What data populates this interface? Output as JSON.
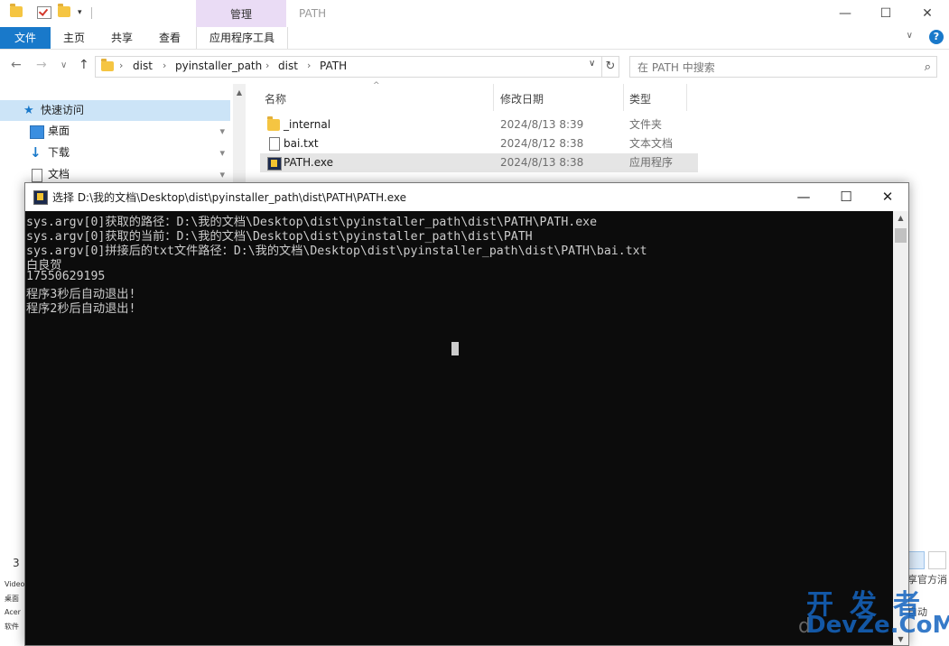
{
  "explorer": {
    "title": "PATH",
    "quick_access_dropdown": "▾",
    "manage_tab": "管理",
    "window_buttons": {
      "minimize": "—",
      "maximize": "☐",
      "close": "✕"
    },
    "ribbon_tabs": [
      "文件",
      "主页",
      "共享",
      "查看",
      "应用程序工具"
    ],
    "ribbon_chevron": "∨",
    "help": "?",
    "nav_buttons": {
      "back": "←",
      "forward": "→",
      "recent": "∨",
      "up": "↑"
    },
    "breadcrumbs": [
      "dist",
      "pyinstaller_path",
      "dist",
      "PATH"
    ],
    "breadcrumb_sep": "›",
    "address_dropdown": "∨",
    "refresh": "↻",
    "search_placeholder": "在 PATH 中搜索",
    "search_glyph": "⌕",
    "nav_pane": {
      "quick_access": "快速访问",
      "items": [
        "桌面",
        "下载",
        "文档"
      ],
      "pin_glyph": "📌"
    },
    "columns": {
      "name": "名称",
      "date": "修改日期",
      "type": "类型",
      "sort_glyph": "^"
    },
    "files": [
      {
        "name": "_internal",
        "date": "2024/8/13 8:39",
        "type": "文件夹",
        "icon": "folder-icon"
      },
      {
        "name": "bai.txt",
        "date": "2024/8/12 8:38",
        "type": "文本文档",
        "icon": "text-file-icon"
      },
      {
        "name": "PATH.exe",
        "date": "2024/8/13 8:38",
        "type": "应用程序",
        "icon": "exe-icon"
      }
    ],
    "status_count": "3",
    "bg_left_labels": [
      "Video",
      "桌面",
      "Acer",
      "软件"
    ],
    "bg_right_texts": [
      "享官方消",
      "自动"
    ]
  },
  "console": {
    "title": "选择 D:\\我的文档\\Desktop\\dist\\pyinstaller_path\\dist\\PATH\\PATH.exe",
    "buttons": {
      "minimize": "—",
      "maximize": "☐",
      "close": "✕"
    },
    "lines": [
      "sys.argv[0]获取的路径：D:\\我的文档\\Desktop\\dist\\pyinstaller_path\\dist\\PATH\\PATH.exe",
      "sys.argv[0]获取的当前：D:\\我的文档\\Desktop\\dist\\pyinstaller_path\\dist\\PATH",
      "sys.argv[0]拼接后的txt文件路径：D:\\我的文档\\Desktop\\dist\\pyinstaller_path\\dist\\PATH\\bai.txt",
      "白良贺",
      "17550629195",
      "程序3秒后自动退出!",
      "程序2秒后自动退出!"
    ],
    "scroll_up": "▲",
    "scroll_down": "▼"
  },
  "watermark": {
    "cn": "开发者",
    "en": "DevZe.CoM",
    "prefix": "d"
  }
}
